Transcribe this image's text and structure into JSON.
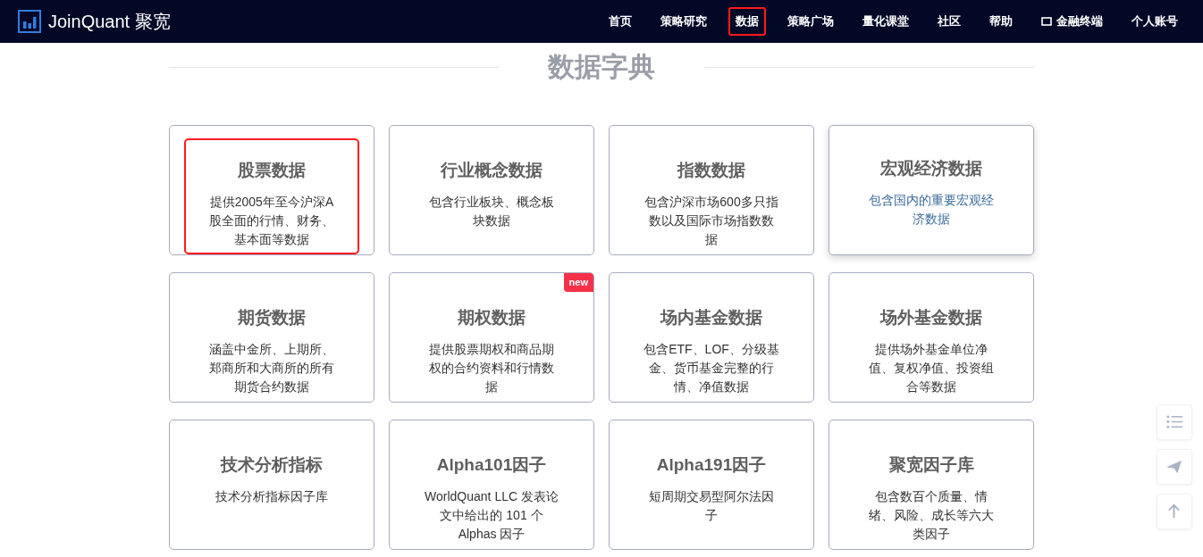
{
  "brand": {
    "name": "JoinQuant 聚宽"
  },
  "nav": [
    {
      "label": "首页",
      "highlighted": false
    },
    {
      "label": "策略研究",
      "highlighted": false
    },
    {
      "label": "数据",
      "highlighted": true
    },
    {
      "label": "策略广场",
      "highlighted": false
    },
    {
      "label": "量化课堂",
      "highlighted": false
    },
    {
      "label": "社区",
      "highlighted": false
    },
    {
      "label": "帮助",
      "highlighted": false
    },
    {
      "label": "金融终端",
      "kind": "terminal",
      "highlighted": false
    },
    {
      "label": "个人账号",
      "highlighted": false
    }
  ],
  "heading": "数据字典",
  "cards": [
    {
      "title": "股票数据",
      "description": "提供2005年至今沪深A股全面的行情、财务、基本面等数据",
      "highlighted": true,
      "hovered": false
    },
    {
      "title": "行业概念数据",
      "description": "包含行业板块、概念板块数据",
      "highlighted": false,
      "hovered": false
    },
    {
      "title": "指数数据",
      "description": "包含沪深市场600多只指数以及国际市场指数数据",
      "highlighted": false,
      "hovered": false
    },
    {
      "title": "宏观经济数据",
      "description": "包含国内的重要宏观经济数据",
      "highlighted": false,
      "hovered": true
    },
    {
      "title": "期货数据",
      "description": "涵盖中金所、上期所、郑商所和大商所的所有期货合约数据",
      "highlighted": false,
      "hovered": false
    },
    {
      "title": "期权数据",
      "description": "提供股票期权和商品期权的合约资料和行情数据",
      "badge": "new",
      "highlighted": false,
      "hovered": false
    },
    {
      "title": "场内基金数据",
      "description": "包含ETF、LOF、分级基金、货币基金完整的行情、净值数据",
      "highlighted": false,
      "hovered": false
    },
    {
      "title": "场外基金数据",
      "description": "提供场外基金单位净值、复权净值、投资组合等数据",
      "highlighted": false,
      "hovered": false
    },
    {
      "title": "技术分析指标",
      "description": "技术分析指标因子库",
      "highlighted": false,
      "hovered": false
    },
    {
      "title": "Alpha101因子",
      "description": "WorldQuant LLC 发表论文中给出的 101 个 Alphas 因子",
      "highlighted": false,
      "hovered": false
    },
    {
      "title": "Alpha191因子",
      "description": "短周期交易型阿尔法因子",
      "highlighted": false,
      "hovered": false
    },
    {
      "title": "聚宽因子库",
      "description": "包含数百个质量、情绪、风险、成长等六大类因子",
      "highlighted": false,
      "hovered": false
    }
  ],
  "float_buttons": [
    {
      "kind": "list"
    },
    {
      "kind": "send"
    },
    {
      "kind": "top"
    }
  ]
}
